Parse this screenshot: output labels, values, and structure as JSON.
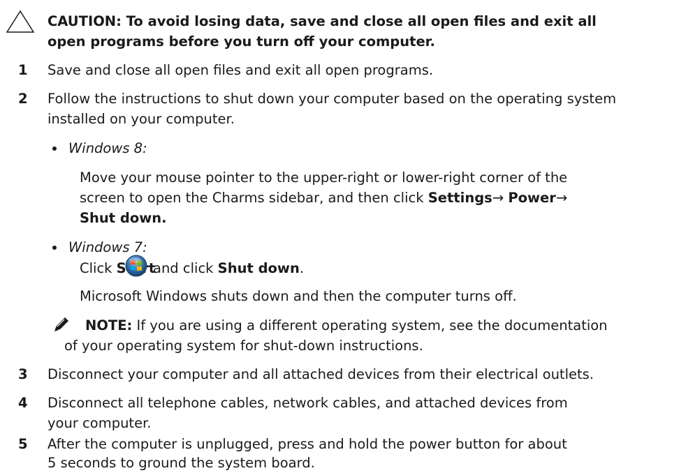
{
  "caution": {
    "line1": "CAUTION: To avoid losing data, save and close all open files and exit all",
    "line2": "open programs before you turn off your computer."
  },
  "steps": [
    {
      "number": "1",
      "line1": "Save and close all open files and exit all open programs."
    },
    {
      "number": "2",
      "line1": "Follow the instructions to shut down your computer based on the operating system",
      "line2": "installed on your computer."
    },
    {
      "number": "3",
      "line1": "Disconnect your computer and all attached devices from their electrical outlets."
    },
    {
      "number": "4",
      "line1": "Disconnect all telephone cables, network cables, and attached devices from",
      "line2": "your computer."
    },
    {
      "number": "5",
      "line1": "After the computer is unplugged, press and hold the power button for about",
      "line2": "5 seconds to ground the system board."
    }
  ],
  "windows8": {
    "label": "Windows 8:",
    "line1": "Move your mouse pointer to the upper-right or lower-right corner of the",
    "line2_pre": "screen to open the Charms sidebar, and then click ",
    "settings": "Settings",
    "power": "Power",
    "arrow": "→",
    "shut_down": "Shut down."
  },
  "windows7": {
    "label": "Windows 7:",
    "click": "Click ",
    "start": "Start",
    "and_click": "and click ",
    "shut_down": "Shut down",
    "period": ".",
    "result": "Microsoft Windows shuts down and then the computer turns off."
  },
  "note": {
    "label": "NOTE:",
    "line1": " If you are using a different operating system, see the documentation",
    "line2": "of your operating system for shut-down instructions."
  },
  "icons": {
    "caution": "warning-triangle-icon",
    "start": "windows-start-orb-icon",
    "note": "pencil-icon"
  }
}
